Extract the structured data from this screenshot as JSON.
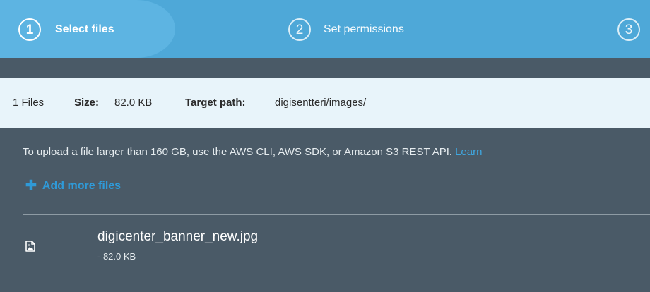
{
  "wizard": {
    "steps": [
      {
        "number": "1",
        "label": "Select files",
        "active": true
      },
      {
        "number": "2",
        "label": "Set permissions",
        "active": false
      },
      {
        "number": "3",
        "label": "",
        "active": false
      }
    ]
  },
  "summary": {
    "files": "1 Files",
    "size_label": "Size:",
    "size_value": "82.0 KB",
    "path_label": "Target path:",
    "path_value": "digisentteri/images/"
  },
  "upload": {
    "notice": "To upload a file larger than 160 GB, use the AWS CLI, AWS SDK, or Amazon S3 REST API.",
    "notice_link": "Learn",
    "add_more_label": "Add more files",
    "add_more_icon": "plus-icon"
  },
  "files": [
    {
      "name": "digicenter_banner_new.jpg",
      "size": "- 82.0 KB",
      "icon": "image-file-icon"
    }
  ],
  "colors": {
    "header": "#4ea8d8",
    "panel": "#4a5a67",
    "summary_bg": "#e8f4fa",
    "link": "#3fa7e0"
  }
}
